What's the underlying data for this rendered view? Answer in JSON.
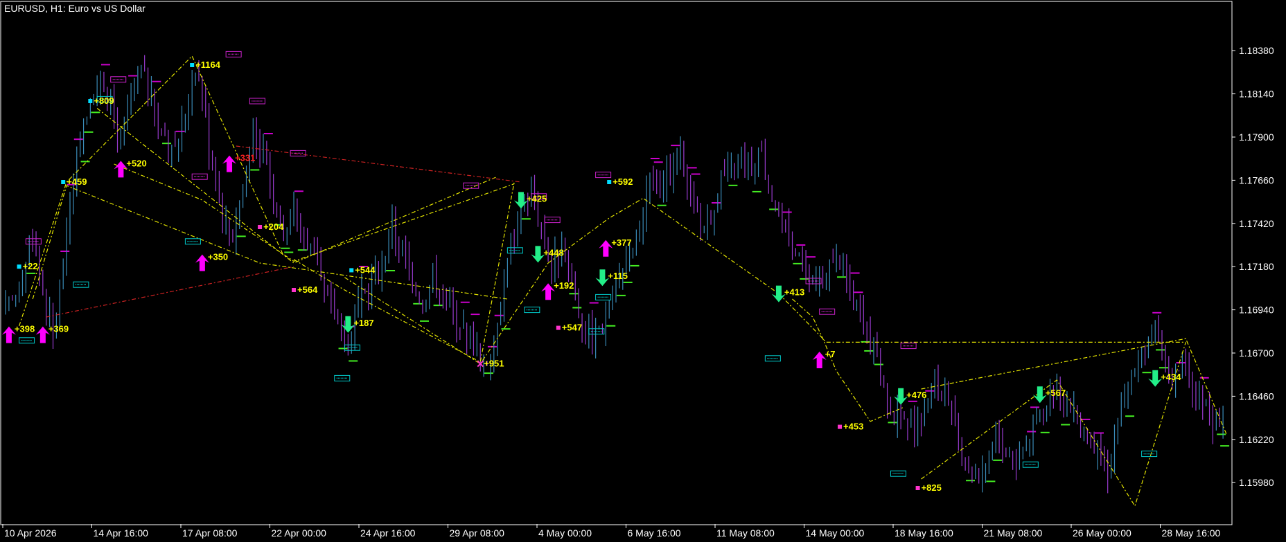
{
  "window": {
    "title": "EURUSD, H1:  Euro vs US Dollar"
  },
  "colors": {
    "background": "#000000",
    "axis": "#ffffff",
    "bar_up": "#3a8bb8",
    "bar_down": "#9a3bd0",
    "buy_arrow": "#ff00ff",
    "sell_arrow": "#22ee88",
    "zigzag_main": "#e6e600",
    "zigzag_alt": "#cc2222",
    "label_yellow": "#ffff00",
    "label_red": "#ff2222",
    "level_green": "#44ee22",
    "level_magenta": "#cc00cc",
    "box_cyan": "#00cccc",
    "box_magenta": "#cc22cc",
    "marker_cyan": "#00ddff",
    "marker_magenta": "#ff33cc"
  },
  "chart_data": {
    "type": "candlestick",
    "symbol": "EURUSD",
    "timeframe": "H1",
    "description": "Euro vs US Dollar",
    "price_axis": {
      "ticks": [
        "1.18380",
        "1.18140",
        "1.17900",
        "1.17660",
        "1.17420",
        "1.17180",
        "1.16940",
        "1.16700",
        "1.16460",
        "1.16220",
        "1.15980"
      ]
    },
    "price_range": [
      1.1575,
      1.1865
    ],
    "time_axis": {
      "ticks": [
        "10 Apr 2026",
        "14 Apr 16:00",
        "17 Apr 08:00",
        "22 Apr 00:00",
        "24 Apr 16:00",
        "29 Apr 08:00",
        "4 May 00:00",
        "6 May 16:00",
        "11 May 08:00",
        "14 May 00:00",
        "18 May 16:00",
        "21 May 08:00",
        "26 May 00:00",
        "28 May 16:00"
      ]
    },
    "price_path": [
      [
        0,
        1.1692
      ],
      [
        3,
        1.1702
      ],
      [
        6,
        1.172
      ],
      [
        8,
        1.1735
      ],
      [
        11,
        1.1705
      ],
      [
        14,
        1.168
      ],
      [
        17,
        1.172
      ],
      [
        19,
        1.1758
      ],
      [
        22,
        1.179
      ],
      [
        25,
        1.1808
      ],
      [
        28,
        1.1822
      ],
      [
        31,
        1.1806
      ],
      [
        34,
        1.1785
      ],
      [
        37,
        1.1812
      ],
      [
        40,
        1.1828
      ],
      [
        43,
        1.181
      ],
      [
        46,
        1.179
      ],
      [
        49,
        1.178
      ],
      [
        52,
        1.1795
      ],
      [
        56,
        1.183
      ],
      [
        58,
        1.1815
      ],
      [
        60,
        1.1785
      ],
      [
        62,
        1.1772
      ],
      [
        64,
        1.1745
      ],
      [
        67,
        1.1735
      ],
      [
        70,
        1.1765
      ],
      [
        73,
        1.179
      ],
      [
        76,
        1.1782
      ],
      [
        79,
        1.1758
      ],
      [
        82,
        1.1738
      ],
      [
        85,
        1.175
      ],
      [
        88,
        1.1735
      ],
      [
        91,
        1.1725
      ],
      [
        93,
        1.1708
      ],
      [
        96,
        1.1695
      ],
      [
        99,
        1.1685
      ],
      [
        102,
        1.1678
      ],
      [
        105,
        1.17
      ],
      [
        108,
        1.1712
      ],
      [
        111,
        1.172
      ],
      [
        114,
        1.174
      ],
      [
        117,
        1.1725
      ],
      [
        120,
        1.1712
      ],
      [
        123,
        1.17
      ],
      [
        126,
        1.1712
      ],
      [
        129,
        1.1705
      ],
      [
        132,
        1.1692
      ],
      [
        135,
        1.1685
      ],
      [
        138,
        1.1675
      ],
      [
        141,
        1.1665
      ],
      [
        143,
        1.1668
      ],
      [
        145,
        1.169
      ],
      [
        147,
        1.1712
      ],
      [
        149,
        1.1728
      ],
      [
        152,
        1.1745
      ],
      [
        155,
        1.176
      ],
      [
        158,
        1.174
      ],
      [
        161,
        1.1718
      ],
      [
        164,
        1.1728
      ],
      [
        167,
        1.1705
      ],
      [
        170,
        1.1688
      ],
      [
        173,
        1.168
      ],
      [
        176,
        1.1686
      ],
      [
        179,
        1.1702
      ],
      [
        182,
        1.1715
      ],
      [
        185,
        1.1722
      ],
      [
        188,
        1.1745
      ],
      [
        190,
        1.177
      ],
      [
        193,
        1.176
      ],
      [
        196,
        1.177
      ],
      [
        199,
        1.1778
      ],
      [
        202,
        1.176
      ],
      [
        205,
        1.174
      ],
      [
        208,
        1.1748
      ],
      [
        211,
        1.1768
      ],
      [
        214,
        1.177
      ],
      [
        217,
        1.1782
      ],
      [
        220,
        1.1773
      ],
      [
        223,
        1.178
      ],
      [
        226,
        1.1758
      ],
      [
        229,
        1.1742
      ],
      [
        232,
        1.1728
      ],
      [
        235,
        1.1718
      ],
      [
        238,
        1.1705
      ],
      [
        241,
        1.1712
      ],
      [
        244,
        1.172
      ],
      [
        247,
        1.1715
      ],
      [
        250,
        1.17
      ],
      [
        253,
        1.1688
      ],
      [
        256,
        1.1672
      ],
      [
        259,
        1.1652
      ],
      [
        262,
        1.1636
      ],
      [
        265,
        1.163
      ],
      [
        268,
        1.1625
      ],
      [
        271,
        1.164
      ],
      [
        274,
        1.1652
      ],
      [
        277,
        1.1642
      ],
      [
        280,
        1.1628
      ],
      [
        283,
        1.161
      ],
      [
        286,
        1.1604
      ],
      [
        289,
        1.161
      ],
      [
        292,
        1.1625
      ],
      [
        295,
        1.1615
      ],
      [
        298,
        1.161
      ],
      [
        301,
        1.1622
      ],
      [
        304,
        1.163
      ],
      [
        307,
        1.1642
      ],
      [
        310,
        1.1652
      ],
      [
        313,
        1.164
      ],
      [
        316,
        1.1632
      ],
      [
        319,
        1.1625
      ],
      [
        322,
        1.1614
      ],
      [
        325,
        1.1605
      ],
      [
        328,
        1.1635
      ],
      [
        331,
        1.165
      ],
      [
        334,
        1.1662
      ],
      [
        337,
        1.1672
      ],
      [
        339,
        1.1682
      ],
      [
        341,
        1.1668
      ],
      [
        344,
        1.1655
      ],
      [
        347,
        1.1662
      ],
      [
        350,
        1.165
      ],
      [
        353,
        1.1642
      ],
      [
        356,
        1.1632
      ],
      [
        360,
        1.1638
      ]
    ],
    "bar_count": 360,
    "zigzag_main": [
      [
        [
          4,
          1.1685
        ],
        [
          18,
          1.1765
        ],
        [
          55,
          1.1835
        ],
        [
          82,
          1.1724
        ]
      ],
      [
        [
          8,
          1.17
        ],
        [
          18,
          1.1763
        ],
        [
          75,
          1.172
        ],
        [
          148,
          1.17
        ]
      ],
      [
        [
          27,
          1.1806
        ],
        [
          85,
          1.172
        ],
        [
          145,
          1.1768
        ]
      ],
      [
        [
          32,
          1.1775
        ],
        [
          58,
          1.1755
        ],
        [
          85,
          1.1721
        ],
        [
          150,
          1.1764
        ]
      ],
      [
        [
          85,
          1.1722
        ],
        [
          100,
          1.1705
        ],
        [
          140,
          1.1665
        ],
        [
          150,
          1.1765
        ]
      ],
      [
        [
          100,
          1.1712
        ],
        [
          140,
          1.1664
        ],
        [
          160,
          1.172
        ]
      ],
      [
        [
          160,
          1.172
        ],
        [
          178,
          1.1745
        ],
        [
          188,
          1.1756
        ],
        [
          228,
          1.1703
        ],
        [
          240,
          1.168
        ],
        [
          242,
          1.1676
        ],
        [
          348,
          1.1676
        ]
      ],
      [
        [
          232,
          1.17
        ],
        [
          238,
          1.169
        ],
        [
          241,
          1.1678
        ],
        [
          245,
          1.166
        ],
        [
          255,
          1.1632
        ],
        [
          265,
          1.164
        ]
      ],
      [
        [
          270,
          1.165
        ],
        [
          348,
          1.1678
        ],
        [
          360,
          1.1625
        ]
      ],
      [
        [
          270,
          1.16
        ],
        [
          310,
          1.1655
        ],
        [
          333,
          1.1585
        ],
        [
          348,
          1.1676
        ]
      ]
    ],
    "zigzag_alt": [
      [
        [
          68,
          1.1785
        ],
        [
          152,
          1.1765
        ]
      ],
      [
        [
          12,
          1.169
        ],
        [
          85,
          1.1718
        ]
      ]
    ],
    "signals": [
      {
        "type": "buy",
        "bar": 1,
        "price": 1.1684,
        "label": "+398"
      },
      {
        "type": "buy",
        "bar": 11,
        "price": 1.1684,
        "label": "+369"
      },
      {
        "type": "buy",
        "bar": 34,
        "price": 1.1776,
        "label": "+520"
      },
      {
        "type": "buy",
        "bar": 58,
        "price": 1.1724,
        "label": "+350"
      },
      {
        "type": "buy",
        "bar": 66,
        "price": 1.1779,
        "label": "+331",
        "color": "red"
      },
      {
        "type": "sell",
        "bar": 101,
        "price": 1.1682,
        "label": "+187"
      },
      {
        "type": "sell",
        "bar": 152,
        "price": 1.1751,
        "label": "+425"
      },
      {
        "type": "sell",
        "bar": 157,
        "price": 1.1721,
        "label": "+448"
      },
      {
        "type": "buy",
        "bar": 160,
        "price": 1.1708,
        "label": "+192"
      },
      {
        "type": "sell",
        "bar": 176,
        "price": 1.1708,
        "label": "+115"
      },
      {
        "type": "buy",
        "bar": 177,
        "price": 1.1732,
        "label": "+377"
      },
      {
        "type": "sell",
        "bar": 228,
        "price": 1.1699,
        "label": "+413"
      },
      {
        "type": "buy",
        "bar": 240,
        "price": 1.167,
        "label": "+7"
      },
      {
        "type": "sell",
        "bar": 264,
        "price": 1.1642,
        "label": "+476"
      },
      {
        "type": "sell",
        "bar": 305,
        "price": 1.1643,
        "label": "+567"
      },
      {
        "type": "sell",
        "bar": 339,
        "price": 1.1652,
        "label": "+434"
      }
    ],
    "markers": [
      {
        "bar": 4,
        "price": 1.1718,
        "label": "+22",
        "color": "cyan"
      },
      {
        "bar": 25,
        "price": 1.181,
        "label": "+809",
        "color": "cyan"
      },
      {
        "bar": 17,
        "price": 1.1765,
        "label": "+459",
        "color": "cyan"
      },
      {
        "bar": 55,
        "price": 1.183,
        "label": "+1164",
        "color": "cyan"
      },
      {
        "bar": 75,
        "price": 1.174,
        "label": "+204",
        "color": "magenta"
      },
      {
        "bar": 85,
        "price": 1.1705,
        "label": "+564",
        "color": "magenta"
      },
      {
        "bar": 102,
        "price": 1.1716,
        "label": "+544",
        "color": "cyan"
      },
      {
        "bar": 140,
        "price": 1.1664,
        "label": "+951",
        "color": "magenta",
        "cross": true
      },
      {
        "bar": 163,
        "price": 1.1684,
        "label": "+547",
        "color": "magenta"
      },
      {
        "bar": 178,
        "price": 1.1765,
        "label": "+592",
        "color": "cyan"
      },
      {
        "bar": 246,
        "price": 1.1629,
        "label": "+453",
        "color": "magenta"
      },
      {
        "bar": 269,
        "price": 1.1595,
        "label": "+825",
        "color": "magenta"
      }
    ],
    "value_boxes": [
      {
        "bar": 27,
        "price": 1.1811,
        "color": "cyan"
      },
      {
        "bar": 31,
        "price": 1.1822,
        "color": "magenta"
      },
      {
        "bar": 4,
        "price": 1.1677,
        "color": "cyan"
      },
      {
        "bar": 20,
        "price": 1.1708,
        "color": "cyan"
      },
      {
        "bar": 6,
        "price": 1.1732,
        "color": "magenta"
      },
      {
        "bar": 53,
        "price": 1.1732,
        "color": "cyan"
      },
      {
        "bar": 55,
        "price": 1.1768,
        "color": "magenta"
      },
      {
        "bar": 65,
        "price": 1.1836,
        "color": "magenta"
      },
      {
        "bar": 72,
        "price": 1.181,
        "color": "magenta"
      },
      {
        "bar": 84,
        "price": 1.1781,
        "color": "magenta"
      },
      {
        "bar": 100,
        "price": 1.1673,
        "color": "cyan"
      },
      {
        "bar": 97,
        "price": 1.1656,
        "color": "cyan"
      },
      {
        "bar": 135,
        "price": 1.1763,
        "color": "magenta"
      },
      {
        "bar": 153,
        "price": 1.1694,
        "color": "cyan"
      },
      {
        "bar": 155,
        "price": 1.1757,
        "color": "magenta"
      },
      {
        "bar": 159,
        "price": 1.1744,
        "color": "magenta"
      },
      {
        "bar": 148,
        "price": 1.1727,
        "color": "cyan"
      },
      {
        "bar": 172,
        "price": 1.1682,
        "color": "cyan"
      },
      {
        "bar": 174,
        "price": 1.1701,
        "color": "cyan"
      },
      {
        "bar": 174,
        "price": 1.1769,
        "color": "magenta"
      },
      {
        "bar": 224,
        "price": 1.1667,
        "color": "cyan"
      },
      {
        "bar": 236,
        "price": 1.171,
        "color": "magenta"
      },
      {
        "bar": 240,
        "price": 1.1693,
        "color": "magenta"
      },
      {
        "bar": 264,
        "price": 1.1674,
        "color": "magenta"
      },
      {
        "bar": 261,
        "price": 1.1603,
        "color": "cyan"
      },
      {
        "bar": 300,
        "price": 1.1608,
        "color": "cyan"
      },
      {
        "bar": 335,
        "price": 1.1614,
        "color": "cyan"
      }
    ]
  }
}
